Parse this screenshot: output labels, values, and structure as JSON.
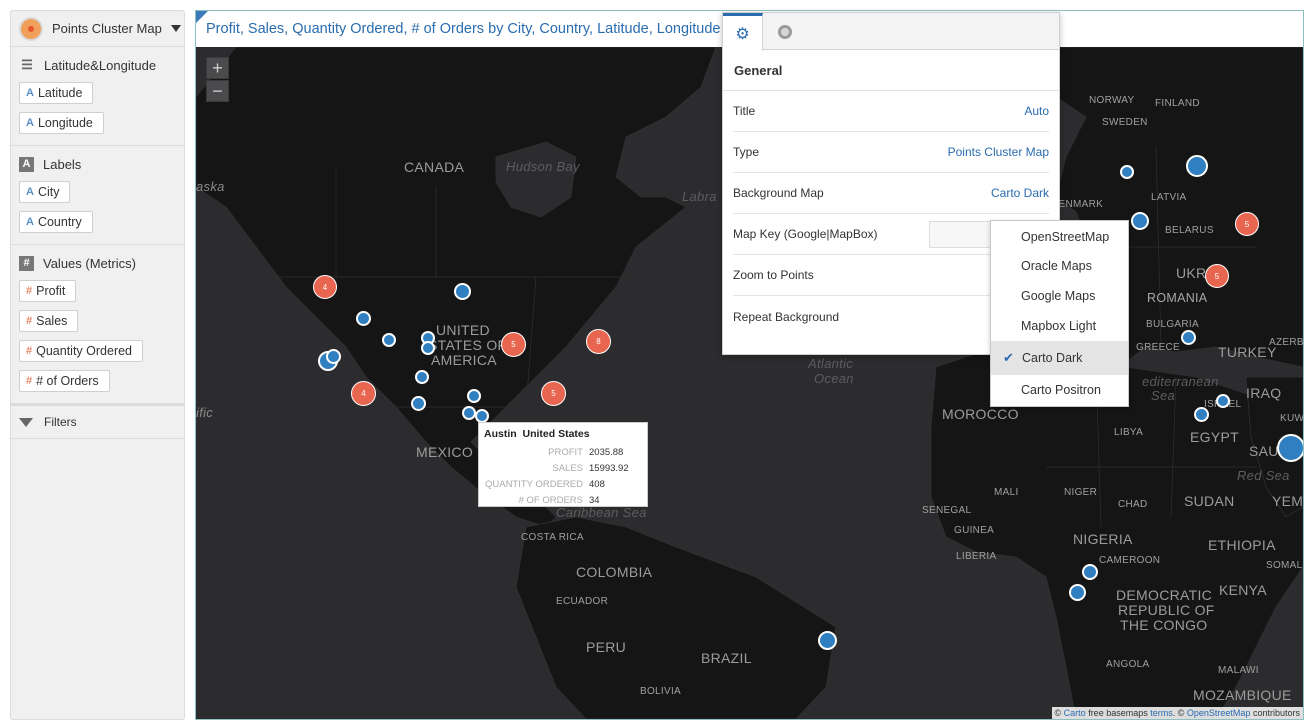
{
  "left_panel": {
    "viz_type": "Points Cluster Map",
    "sections": [
      {
        "title": "Latitude&Longitude",
        "icon": "grid-icon",
        "items": [
          {
            "label": "Latitude",
            "type": "attribute"
          },
          {
            "label": "Longitude",
            "type": "attribute"
          }
        ]
      },
      {
        "title": "Labels",
        "icon": "label-icon",
        "items": [
          {
            "label": "City",
            "type": "attribute"
          },
          {
            "label": "Country",
            "type": "attribute"
          }
        ]
      },
      {
        "title": "Values (Metrics)",
        "icon": "hash-icon",
        "items": [
          {
            "label": "Profit",
            "type": "metric"
          },
          {
            "label": "Sales",
            "type": "metric"
          },
          {
            "label": "Quantity Ordered",
            "type": "metric"
          },
          {
            "label": "# of Orders",
            "type": "metric"
          }
        ]
      }
    ],
    "filters": "Filters"
  },
  "main": {
    "title": "Profit, Sales, Quantity Ordered, # of Orders by City, Country, Latitude, Longitude",
    "zoom_in": "+",
    "zoom_out": "−"
  },
  "map": {
    "labels": {
      "canada": "CANADA",
      "hudson": "Hudson Bay",
      "labrador": "Labra",
      "alaska": "aska",
      "united": "UNITED",
      "states_of": "STATES OF",
      "america": "AMERICA",
      "mexico": "MEXICO",
      "pacific": "ific",
      "caribbean": "Caribbean Sea",
      "costarica": "COSTA RICA",
      "colombia": "COLOMBIA",
      "ecuador": "ECUADOR",
      "peru": "PERU",
      "brazil": "BRAZIL",
      "bolivia": "BOLIVIA",
      "atlantic": "Atlantic",
      "ocean": "Ocean",
      "norway": "NORWAY",
      "finland": "FINLAND",
      "sweden": "SWEDEN",
      "denmark": "DENMARK",
      "latvia": "LATVIA",
      "belarus": "BELARUS",
      "ukraine": "UKRA",
      "romania": "ROMANIA",
      "bulgaria": "BULGARIA",
      "greece": "GREECE",
      "turkey": "TURKEY",
      "azerbaijan": "AZERBA",
      "mediterranean": "editerranean",
      "sea": "Sea",
      "iraq": "IRAQ",
      "kuwait": "KUWA",
      "israel": "ISRAEL",
      "morocco": "MOROCCO",
      "libya": "LIBYA",
      "egypt": "EGYPT",
      "saudi": "SAUDI",
      "red_sea": "Red Sea",
      "yemen": "YEM",
      "mali": "MALI",
      "niger": "NIGER",
      "chad": "CHAD",
      "sudan": "SUDAN",
      "senegal": "SENEGAL",
      "guinea": "GUINEA",
      "liberia": "LIBERIA",
      "nigeria": "NIGERIA",
      "ethiopia": "ETHIOPIA",
      "somalia": "SOMALIA",
      "cameroon": "CAMEROON",
      "drc1": "DEMOCRATIC",
      "drc2": "REPUBLIC OF",
      "drc3": "THE CONGO",
      "kenya": "KENYA",
      "angola": "ANGOLA",
      "malawi": "MALAWI",
      "mozambique": "MOZAMBIQUE"
    },
    "clusters": [
      {
        "count": "4"
      },
      {
        "count": "5"
      },
      {
        "count": "8"
      },
      {
        "count": "4"
      },
      {
        "count": "5"
      },
      {
        "count": "5"
      },
      {
        "count": "5"
      }
    ],
    "tooltip": {
      "city": "Austin",
      "country": "United States",
      "rows": [
        {
          "key": "PROFIT",
          "value": "2035.88"
        },
        {
          "key": "SALES",
          "value": "15993.92"
        },
        {
          "key": "QUANTITY ORDERED",
          "value": "408"
        },
        {
          "key": "# OF ORDERS",
          "value": "34"
        }
      ]
    },
    "attribution": {
      "pre": "©",
      "carto": "Carto",
      "mid": "free basemaps",
      "terms": "terms",
      "post": ". ©",
      "osm": "OpenStreetMap",
      "end": "contributors"
    }
  },
  "properties": {
    "section": "General",
    "rows": [
      {
        "label": "Title",
        "value": "Auto"
      },
      {
        "label": "Type",
        "value": "Points Cluster Map"
      },
      {
        "label": "Background Map",
        "value": "Carto Dark"
      },
      {
        "label": "Map Key (Google|MapBox)",
        "value": ""
      },
      {
        "label": "Zoom to Points",
        "value": ""
      },
      {
        "label": "Repeat Background",
        "value": ""
      }
    ]
  },
  "bg_menu": {
    "options": [
      "OpenStreetMap",
      "Oracle Maps",
      "Google Maps",
      "Mapbox Light",
      "Carto Dark",
      "Carto Positron"
    ],
    "selected": "Carto Dark"
  },
  "colors": {
    "accent": "#2a6cb0",
    "map_bg": "#2c2c2e",
    "land": "#151515",
    "marker_blue": "#2f7fc1",
    "marker_red": "#e8654f"
  }
}
